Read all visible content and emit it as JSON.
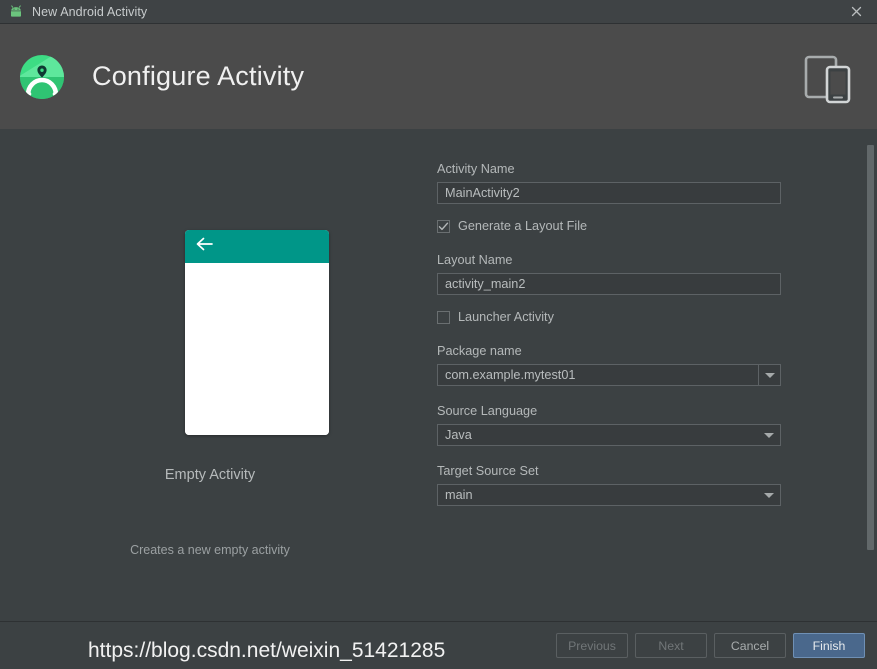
{
  "window": {
    "title": "New Android Activity",
    "icon": "android-robot-icon",
    "close_label": "×"
  },
  "header": {
    "title": "Configure Activity",
    "logo_icon": "android-studio-logo-icon",
    "device_icon": "tablet-phone-device-icon"
  },
  "preview": {
    "template_name": "Empty Activity",
    "description": "Creates a new empty activity",
    "appbar_color": "#009688",
    "back_icon": "back-arrow-icon"
  },
  "form": {
    "activity_name": {
      "label": "Activity Name",
      "value": "MainActivity2",
      "placeholder": "Activity Name"
    },
    "generate_layout": {
      "label": "Generate a Layout File",
      "checked": true,
      "check_glyph": "✓"
    },
    "layout_name": {
      "label": "Layout Name",
      "value": "activity_main2",
      "placeholder": "Layout Name"
    },
    "launcher_activity": {
      "label": "Launcher Activity",
      "checked": false,
      "check_glyph": ""
    },
    "package_name": {
      "label": "Package name",
      "value": "com.example.mytest01"
    },
    "source_language": {
      "label": "Source Language",
      "value": "Java"
    },
    "target_source_set": {
      "label": "Target Source Set",
      "value": "main"
    }
  },
  "footer": {
    "previous": "Previous",
    "next": "Next",
    "cancel": "Cancel",
    "finish": "Finish"
  },
  "watermark": {
    "text": "https://blog.csdn.net/weixin_51421285"
  }
}
